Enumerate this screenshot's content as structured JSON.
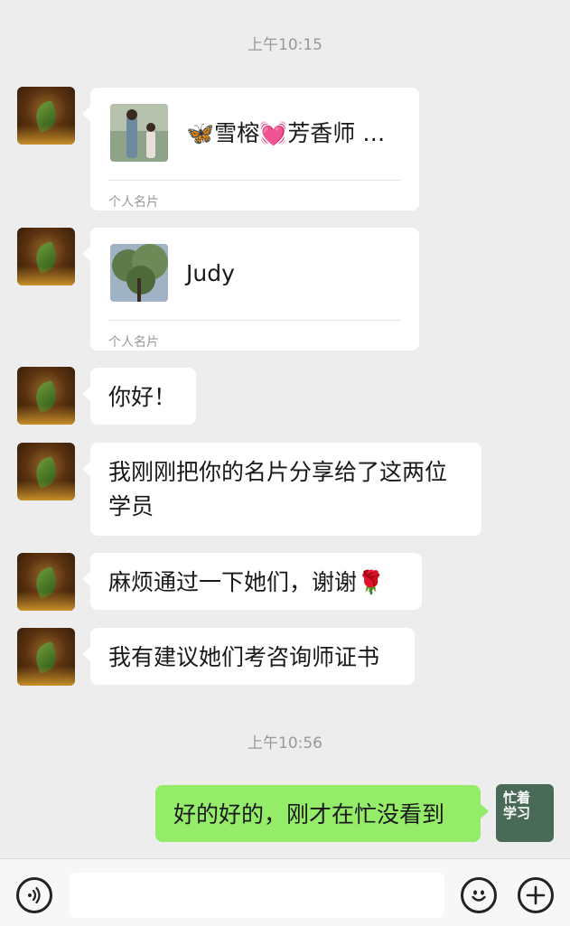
{
  "timestamps": [
    "上午10:15",
    "上午10:56"
  ],
  "messages": [
    {
      "type": "card",
      "name": "🦋雪榕💓芳香师 …",
      "card_type": "个人名片"
    },
    {
      "type": "card",
      "name": "Judy",
      "card_type": "个人名片"
    },
    {
      "type": "text",
      "text": "你好！"
    },
    {
      "type": "text",
      "text_line1": "我刚刚把你的名片分享给了这两位",
      "text_line2": "学员"
    },
    {
      "type": "text",
      "text": "麻烦通过一下她们，谢谢🌹"
    },
    {
      "type": "text",
      "text": "我有建议她们考咨询师证书"
    },
    {
      "type": "text",
      "text": "好的好的，刚才在忙没看到",
      "from": "me"
    }
  ],
  "my_avatar": {
    "line1": "忙着",
    "line2": "学习"
  },
  "input": {
    "placeholder": ""
  },
  "icons": {
    "voice": "voice-icon",
    "emoji": "emoji-icon",
    "add": "add-icon"
  },
  "colors": {
    "background": "#ededed",
    "my_bubble": "#95ec69",
    "their_bubble": "#ffffff",
    "timestamp": "#999999"
  }
}
